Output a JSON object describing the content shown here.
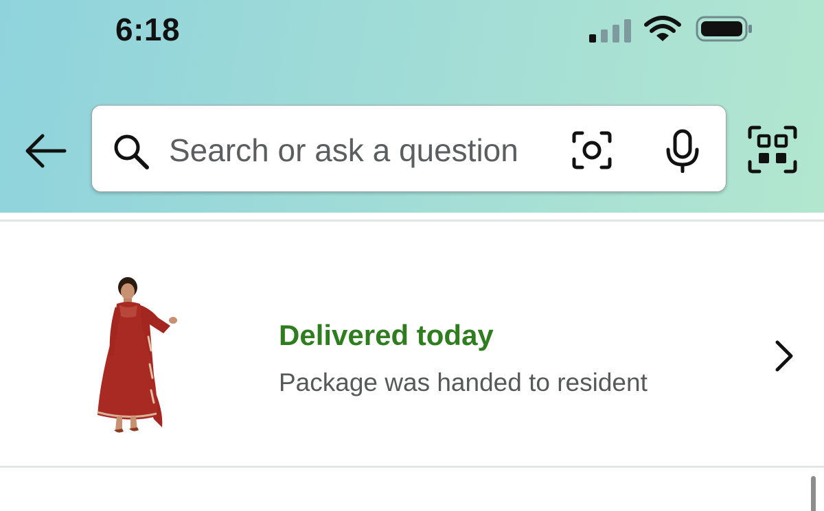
{
  "status_bar": {
    "time": "6:18",
    "signal_bars_active": 1,
    "signal_bars_total": 4
  },
  "header": {
    "back_icon": "arrow-left-icon",
    "search": {
      "placeholder": "Search or ask a question",
      "value": "",
      "left_icon": "search-icon",
      "camera_icon": "camera-lens-icon",
      "mic_icon": "microphone-icon"
    },
    "scan_icon": "qr-scan-icon",
    "gradient_colors": [
      "#8fd3dc",
      "#b2e6cf"
    ]
  },
  "order": {
    "product_image": "red-anarkali-dress-with-dupatta",
    "status": "Delivered today",
    "detail": "Package was handed to resident",
    "status_color": "#2e7d1e"
  }
}
